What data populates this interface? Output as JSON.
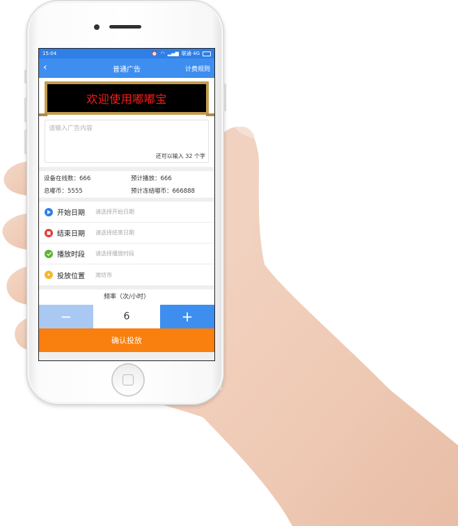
{
  "statusbar": {
    "time": "15:04",
    "carrier": "联通 4G",
    "battery": "▮"
  },
  "navbar": {
    "back": "‹",
    "title": "普通广告",
    "rule": "计费规则"
  },
  "banner": {
    "text": "欢迎使用嘟嘟宝"
  },
  "content_input": {
    "placeholder": "请输入广告内容",
    "count": "还可以输入 32 个字"
  },
  "stats": [
    "设备在线数：666",
    "预计播放：666",
    "总嘟币：5555",
    "预计冻结嘟币：666888"
  ],
  "settings": [
    {
      "label": "开始日期",
      "hint": "请选择开始日期",
      "icon": "play-icon",
      "color": "#2f7fe6"
    },
    {
      "label": "结束日期",
      "hint": "请选择结束日期",
      "icon": "stop-icon",
      "color": "#e53935"
    },
    {
      "label": "播放时段",
      "hint": "请选择播放时段",
      "icon": "check-icon",
      "color": "#5cb531"
    },
    {
      "label": "投放位置",
      "hint": "潍坊市",
      "icon": "location-pin-icon",
      "color": "#f5b82e"
    }
  ],
  "frequency": {
    "title": "频率（次/小时）",
    "minus": "−",
    "value": "6",
    "plus": "+"
  },
  "confirm": {
    "label": "确认投放"
  },
  "colors": {
    "accent": "#3e8ef0",
    "confirm": "#f97f0f",
    "banner_text": "#ff1a1a"
  }
}
